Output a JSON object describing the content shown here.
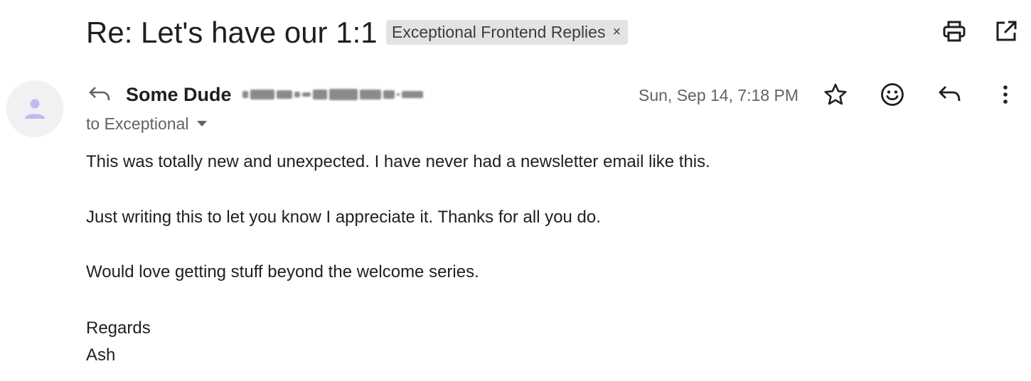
{
  "subject": "Re: Let's have our 1:1",
  "label": {
    "name": "Exceptional Frontend Replies",
    "remove_glyph": "×"
  },
  "header_actions": {
    "print_icon": "print-icon",
    "open_new_window_icon": "open-in-new-window-icon"
  },
  "message": {
    "sender_name": "Some Dude",
    "sender_email_redacted": true,
    "recipients": "to Exceptional",
    "date": "Sun, Sep 14, 7:18 PM",
    "icons": {
      "star": "star-icon",
      "emoji": "emoji-react-icon",
      "reply": "reply-icon",
      "more": "more-vert-icon"
    },
    "body": [
      "This was totally new and unexpected. I have never had a newsletter email like this.",
      "Just writing this to let you know I appreciate it. Thanks for all you do.",
      "Would love getting stuff beyond the welcome series.",
      "Regards",
      "Ash"
    ]
  },
  "colors": {
    "text_primary": "#1f1f1f",
    "text_secondary": "#5f6368",
    "chip_background": "#e3e3e3",
    "avatar_background": "#f1f1f3",
    "avatar_figure": "#c7b6f0"
  }
}
